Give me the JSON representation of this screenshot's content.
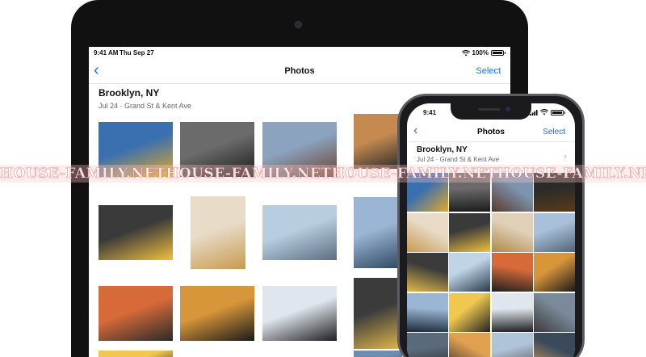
{
  "ipad": {
    "status": {
      "time": "9:41 AM",
      "date": "Thu Sep 27",
      "battery": "100%",
      "battery_level": 1.0
    },
    "nav": {
      "back_icon": "chevron-left-icon",
      "title": "Photos",
      "select": "Select"
    },
    "header": {
      "location": "Brooklyn, NY",
      "subtitle": "Jul 24 · Grand St & Kent Ave"
    },
    "photos": [
      {
        "name": "bridge-sunflower",
        "colors": [
          "#3a6fb0",
          "#e0a829"
        ]
      },
      {
        "name": "garage-door-man",
        "colors": [
          "#6b6b6b",
          "#1a1a1a"
        ]
      },
      {
        "name": "woman-sunglasses-bridge",
        "colors": [
          "#8ba3bf",
          "#6b4330"
        ]
      },
      {
        "name": "man-sunset-portrait",
        "colors": [
          "#c48a50",
          "#2a2a2a"
        ]
      },
      {
        "name": "man-stairs-yellow",
        "colors": [
          "#3a3a3a",
          "#f0c040"
        ]
      },
      {
        "name": "curly-hair-woman",
        "colors": [
          "#e8dcc8",
          "#c89a50"
        ]
      },
      {
        "name": "skyline-man-walking",
        "colors": [
          "#b8cde0",
          "#5b6f80"
        ]
      },
      {
        "name": "city-skyline-river",
        "colors": [
          "#9bb6d4",
          "#2d4660"
        ]
      },
      {
        "name": "orange-wall-jump",
        "colors": [
          "#d86a3a",
          "#2a2a2a"
        ]
      },
      {
        "name": "sunset-pier",
        "colors": [
          "#d8963a",
          "#1a1a1a"
        ]
      },
      {
        "name": "window-silhouettes",
        "colors": [
          "#dfe6ee",
          "#1e1e1e"
        ]
      },
      {
        "name": "man-yellow-shirt-edge",
        "colors": [
          "#3b3b3b",
          "#e0b84a"
        ]
      },
      {
        "name": "skyline-edge",
        "colors": [
          "#6d8eb0",
          "#223344"
        ]
      },
      {
        "name": "man-standing-dark",
        "colors": [
          "#f0c850",
          "#222222"
        ]
      }
    ]
  },
  "iphone": {
    "status": {
      "time": "9:41",
      "battery_level": 1.0
    },
    "nav": {
      "back_icon": "chevron-left-icon",
      "title": "Photos",
      "select": "Select"
    },
    "header": {
      "location": "Brooklyn, NY",
      "subtitle": "Jul 24 · Grand St & Kent Ave",
      "chevron_icon": "chevron-right-icon"
    },
    "grid": [
      [
        "#3a6fb0",
        "#e0a829"
      ],
      [
        "#6b6b6b",
        "#1a1a1a"
      ],
      [
        "#7d94b0",
        "#5a3a2a"
      ],
      [
        "#2b2b2b",
        "#5a3a1a"
      ],
      [
        "#e8dcc8",
        "#c89a50"
      ],
      [
        "#3a3a3a",
        "#f0c040"
      ],
      [
        "#e0d0b8",
        "#b08848"
      ],
      [
        "#a8c0d8",
        "#506478"
      ],
      [
        "#3b3b3b",
        "#e0b84a"
      ],
      [
        "#c0d4e8",
        "#2a3a4a"
      ],
      [
        "#d86a3a",
        "#1f1f1f"
      ],
      [
        "#d8963a",
        "#1a1a1a"
      ],
      [
        "#9bb6d4",
        "#1a2a3a"
      ],
      [
        "#f0c850",
        "#222222"
      ],
      [
        "#dfe6ee",
        "#1e1e1e"
      ],
      [
        "#7a8a9a",
        "#3a3a3a"
      ],
      [
        "#5a6a7a",
        "#2a2a2a"
      ],
      [
        "#e0a050",
        "#303030"
      ],
      [
        "#b0c4d8",
        "#505050"
      ],
      [
        "#3a4a5a",
        "#d0a060"
      ]
    ]
  },
  "watermark": {
    "text": "HOUSE-FAMILY.NET"
  }
}
